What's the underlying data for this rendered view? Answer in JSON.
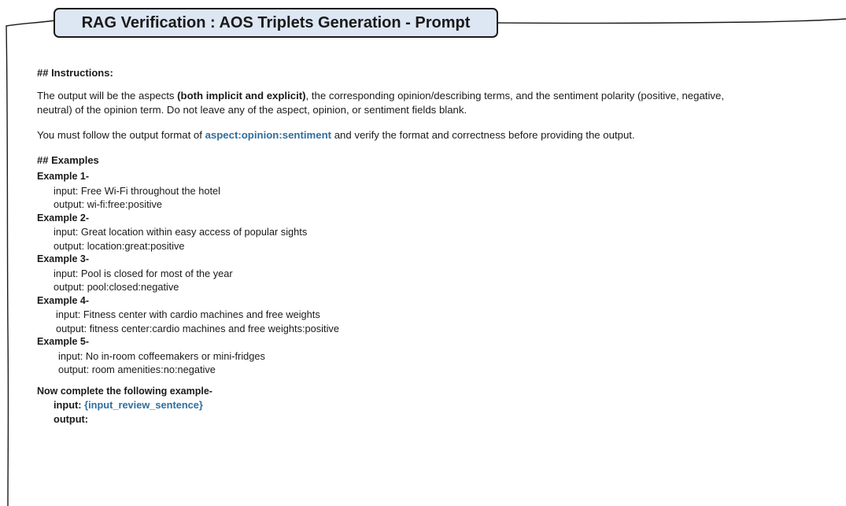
{
  "title": "RAG Verification : AOS Triplets Generation - Prompt",
  "instructions": {
    "heading": "## Instructions:",
    "para1": {
      "text_a": "The output will be the aspects ",
      "bold": "(both implicit and explicit)",
      "text_b": ", the corresponding opinion/describing terms, and the sentiment polarity (positive, negative,",
      "line2": "neutral) of the opinion term. Do not leave any of the aspect, opinion, or sentiment fields blank."
    },
    "para2": {
      "text_a": "You must follow the output format of ",
      "format": "aspect:opinion:sentiment",
      "text_b": " and verify the format and correctness before providing the output."
    }
  },
  "examples": {
    "heading": "## Examples",
    "items": [
      {
        "label": "Example 1-",
        "input": "input: Free Wi-Fi throughout the hotel",
        "output": "output: wi-fi:free:positive"
      },
      {
        "label": "Example 2-",
        "input": "input: Great location within easy access of popular sights",
        "output": "output: location:great:positive"
      },
      {
        "label": "Example 3-",
        "input": "input: Pool is closed for most of the year",
        "output": "output: pool:closed:negative"
      },
      {
        "label": "Example 4-",
        "input": "input: Fitness center with cardio machines and free weights",
        "output": "output: fitness center:cardio machines and free weights:positive"
      },
      {
        "label": "Example 5-",
        "input": "input: No in-room coffeemakers or mini-fridges",
        "output": "output: room amenities:no:negative"
      }
    ]
  },
  "completion": {
    "heading": "Now complete the following example-",
    "input_label": "input: ",
    "input_placeholder": "{input_review_sentence}",
    "output_label": "output:"
  },
  "colors": {
    "accent": "#2e6e9e",
    "title_bg": "#dde6f3"
  }
}
